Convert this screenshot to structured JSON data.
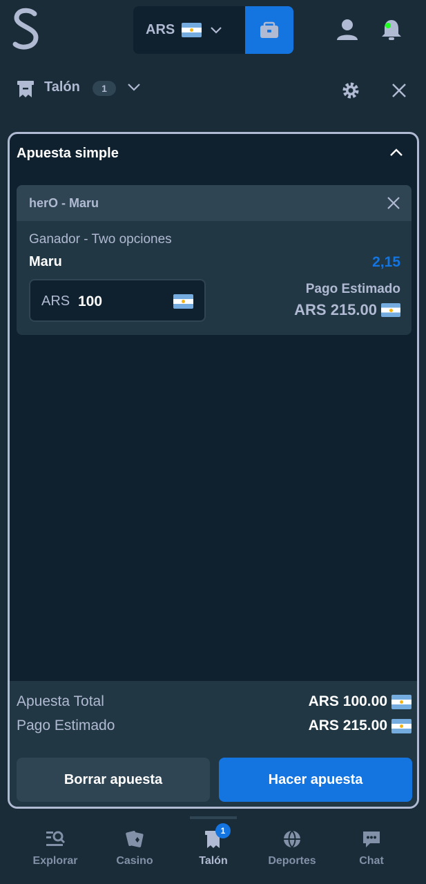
{
  "header": {
    "currency": "ARS",
    "logo_letter": "S"
  },
  "slip": {
    "title": "Talón",
    "count": "1"
  },
  "panel": {
    "title": "Apuesta simple",
    "bet": {
      "match": "herO - Maru",
      "market": "Ganador - Two opciones",
      "selection": "Maru",
      "odds": "2,15",
      "stake_currency": "ARS",
      "stake_value": "100",
      "estimated_label": "Pago Estimado",
      "estimated_value": "ARS 215.00"
    },
    "summary": {
      "total_label": "Apuesta Total",
      "total_value": "ARS 100.00",
      "payout_label": "Pago Estimado",
      "payout_value": "ARS 215.00"
    },
    "buttons": {
      "clear": "Borrar apuesta",
      "place": "Hacer apuesta"
    }
  },
  "nav": {
    "items": [
      {
        "label": "Explorar"
      },
      {
        "label": "Casino"
      },
      {
        "label": "Talón",
        "badge": "1"
      },
      {
        "label": "Deportes"
      },
      {
        "label": "Chat"
      }
    ]
  },
  "colors": {
    "background": "#1a2c38",
    "panel": "#0f212e",
    "card": "#213743",
    "accent": "#1475e1",
    "muted_text": "#b1bad3"
  }
}
